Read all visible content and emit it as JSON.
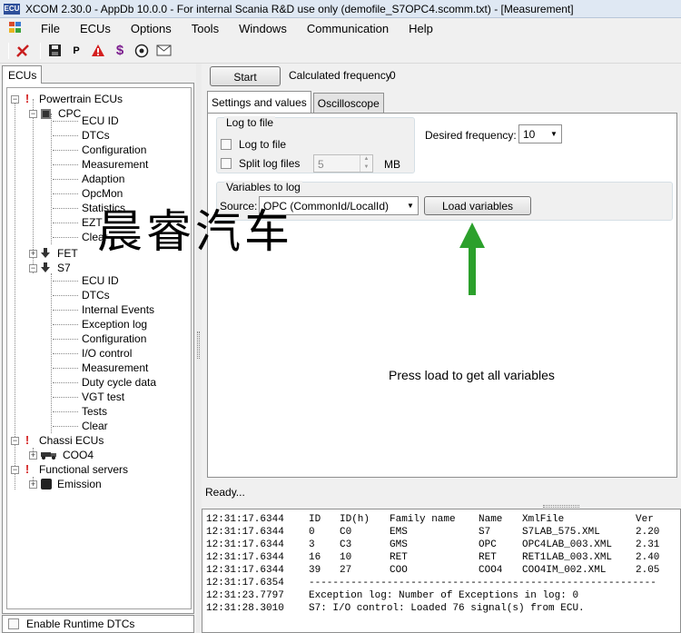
{
  "window": {
    "app_icon_text": "ECU",
    "title": "XCOM 2.30.0 - AppDb 10.0.0 - For internal Scania R&D use only (demofile_S7OPC4.scomm.txt) - [Measurement]"
  },
  "menu": {
    "items": [
      "File",
      "ECUs",
      "Options",
      "Tools",
      "Windows",
      "Communication",
      "Help"
    ]
  },
  "toolbar": {
    "icons": [
      "connect-icon",
      "save-icon",
      "p-icon",
      "warning-icon",
      "dollar-icon",
      "settings-circle-icon",
      "mail-icon"
    ],
    "p_label": "P",
    "dollar_label": "$"
  },
  "left": {
    "tab_label": "ECUs",
    "tree": {
      "powertrain": "Powertrain ECUs",
      "cpc": "CPC",
      "cpc_children": [
        "ECU ID",
        "DTCs",
        "Configuration",
        "Measurement",
        "Adaption",
        "OpcMon",
        "Statistics",
        "EZT",
        "Clear"
      ],
      "fet": "FET",
      "s7": "S7",
      "s7_children": [
        "ECU ID",
        "DTCs",
        "Internal Events",
        "Exception log",
        "Configuration",
        "I/O control",
        "Measurement",
        "Duty cycle data",
        "VGT test",
        "Tests",
        "Clear"
      ],
      "chassi": "Chassi ECUs",
      "coo4": "COO4",
      "functional": "Functional servers",
      "emission": "Emission"
    },
    "enable_runtime_dtcs": "Enable Runtime DTCs"
  },
  "measurement": {
    "start_label": "Start",
    "calc_freq_label": "Calculated frequency",
    "calc_freq_value": "0",
    "tabs": [
      "Settings and values",
      "Oscilloscope"
    ],
    "log_to_file_group": "Log to file",
    "log_to_file_checkbox": "Log to file",
    "split_log_files_checkbox": "Split log files",
    "split_value": "5",
    "split_unit": "MB",
    "desired_freq_label": "Desired frequency:",
    "desired_freq_value": "10",
    "variables_group": "Variables to log",
    "source_label": "Source:",
    "source_value": "OPC (CommonId/LocalId)",
    "load_variables_label": "Load variables",
    "hint_text": "Press load to get all variables",
    "status": "Ready..."
  },
  "watermark": "晨睿汽车",
  "colors": {
    "arrow": "#2ca02c",
    "error_icon": "#d42020"
  },
  "log": {
    "lines": [
      {
        "time": "12:31:17.6344",
        "c1": "ID",
        "c2": "ID(h)",
        "c3": "Family name",
        "c4": "Name",
        "c5": "XmlFile",
        "c6": "Ver"
      },
      {
        "time": "12:31:17.6344",
        "c1": "0",
        "c2": "C0",
        "c3": "EMS",
        "c4": "S7",
        "c5": "S7LAB_575.XML",
        "c6": "2.20"
      },
      {
        "time": "12:31:17.6344",
        "c1": "3",
        "c2": "C3",
        "c3": "GMS",
        "c4": "OPC",
        "c5": "OPC4LAB_003.XML",
        "c6": "2.31"
      },
      {
        "time": "12:31:17.6344",
        "c1": "16",
        "c2": "10",
        "c3": "RET",
        "c4": "RET",
        "c5": "RET1LAB_003.XML",
        "c6": "2.40"
      },
      {
        "time": "12:31:17.6344",
        "c1": "39",
        "c2": "27",
        "c3": "COO",
        "c4": "COO4",
        "c5": "COO4IM_002.XML",
        "c6": "2.05"
      },
      {
        "time": "12:31:17.6354",
        "c1": "----------------------------------------------------------",
        "c2": "",
        "c3": "",
        "c4": "",
        "c5": "",
        "c6": ""
      },
      {
        "time": "12:31:23.7797",
        "c1": "Exception log: Number of Exceptions in log: 0",
        "c2": "",
        "c3": "",
        "c4": "",
        "c5": "",
        "c6": ""
      },
      {
        "time": "12:31:28.3010",
        "c1": "S7: I/O control: Loaded 76 signal(s) from ECU.",
        "c2": "",
        "c3": "",
        "c4": "",
        "c5": "",
        "c6": ""
      }
    ]
  }
}
